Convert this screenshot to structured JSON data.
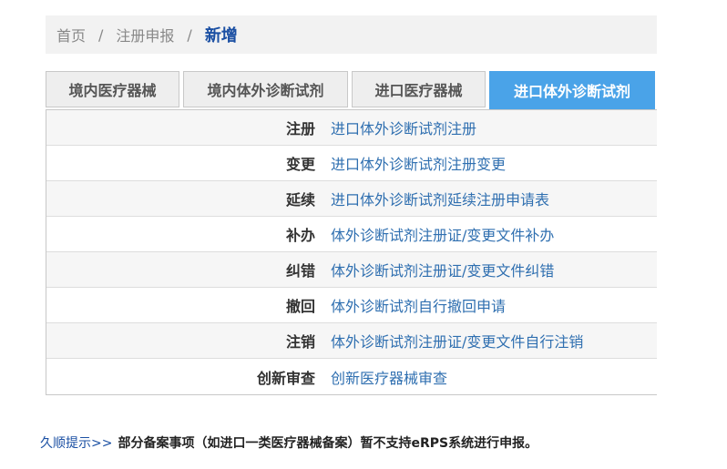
{
  "breadcrumb": {
    "home": "首页",
    "separator": "/",
    "section": "注册申报",
    "current": "新增"
  },
  "tabs": [
    {
      "label": "境内医疗器械",
      "active": false
    },
    {
      "label": "境内体外诊断试剂",
      "active": false
    },
    {
      "label": "进口医疗器械",
      "active": false
    },
    {
      "label": "进口体外诊断试剂",
      "active": true
    }
  ],
  "rows": [
    {
      "label": "注册",
      "link": "进口体外诊断试剂注册"
    },
    {
      "label": "变更",
      "link": "进口体外诊断试剂注册变更"
    },
    {
      "label": "延续",
      "link": "进口体外诊断试剂延续注册申请表"
    },
    {
      "label": "补办",
      "link": "体外诊断试剂注册证/变更文件补办"
    },
    {
      "label": "纠错",
      "link": "体外诊断试剂注册证/变更文件纠错"
    },
    {
      "label": "撤回",
      "link": "体外诊断试剂自行撤回申请"
    },
    {
      "label": "注销",
      "link": "体外诊断试剂注册证/变更文件自行注销"
    },
    {
      "label": "创新审查",
      "link": "创新医疗器械审查"
    }
  ],
  "tip": {
    "label": "久顺提示>>",
    "text": "部分备案事项（如进口一类医疗器械备案）暂不支持eRPS系统进行申报。"
  },
  "colors": {
    "active_tab": "#4aa3e8",
    "link": "#2f6fb0",
    "current_crumb": "#1a4fa3"
  }
}
